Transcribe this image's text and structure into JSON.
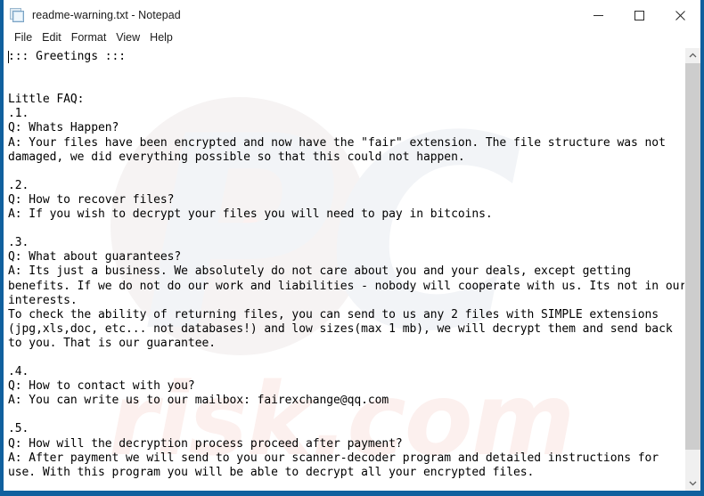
{
  "window": {
    "title": "readme-warning.txt - Notepad",
    "app_icon": "notepad-icon",
    "border_color": "#10609e"
  },
  "window_controls": [
    {
      "name": "minimize",
      "glyph": "minimize-icon",
      "label": "Minimize"
    },
    {
      "name": "maximize",
      "glyph": "maximize-icon",
      "label": "Maximize"
    },
    {
      "name": "close",
      "glyph": "close-icon",
      "label": "Close"
    }
  ],
  "menubar": {
    "items": [
      {
        "label": "File"
      },
      {
        "label": "Edit"
      },
      {
        "label": "Format"
      },
      {
        "label": "View"
      },
      {
        "label": "Help"
      }
    ]
  },
  "document": {
    "filename": "readme-warning.txt",
    "content": "::: Greetings :::\n\n\nLittle FAQ:\n.1.\nQ: Whats Happen?\nA: Your files have been encrypted and now have the \"fair\" extension. The file structure was not\ndamaged, we did everything possible so that this could not happen.\n\n.2.\nQ: How to recover files?\nA: If you wish to decrypt your files you will need to pay in bitcoins.\n\n.3.\nQ: What about guarantees?\nA: Its just a business. We absolutely do not care about you and your deals, except getting\nbenefits. If we do not do our work and liabilities - nobody will cooperate with us. Its not in our\ninterests.\nTo check the ability of returning files, you can send to us any 2 files with SIMPLE extensions\n(jpg,xls,doc, etc... not databases!) and low sizes(max 1 mb), we will decrypt them and send back\nto you. That is our guarantee.\n\n.4.\nQ: How to contact with you?\nA: You can write us to our mailbox: fairexchange@qq.com\n\n.5.\nQ: How will the decryption process proceed after payment?\nA: After payment we will send to you our scanner-decoder program and detailed instructions for\nuse. With this program you will be able to decrypt all your encrypted files.",
    "contact_email": "fairexchange@qq.com",
    "file_extension": "fair"
  },
  "scrollbar": {
    "up_arrow": "chevron-up-icon",
    "down_arrow": "chevron-down-icon",
    "thumb_position": "top"
  },
  "watermark": {
    "logo_text": "PC",
    "site_text": "risk.com"
  }
}
